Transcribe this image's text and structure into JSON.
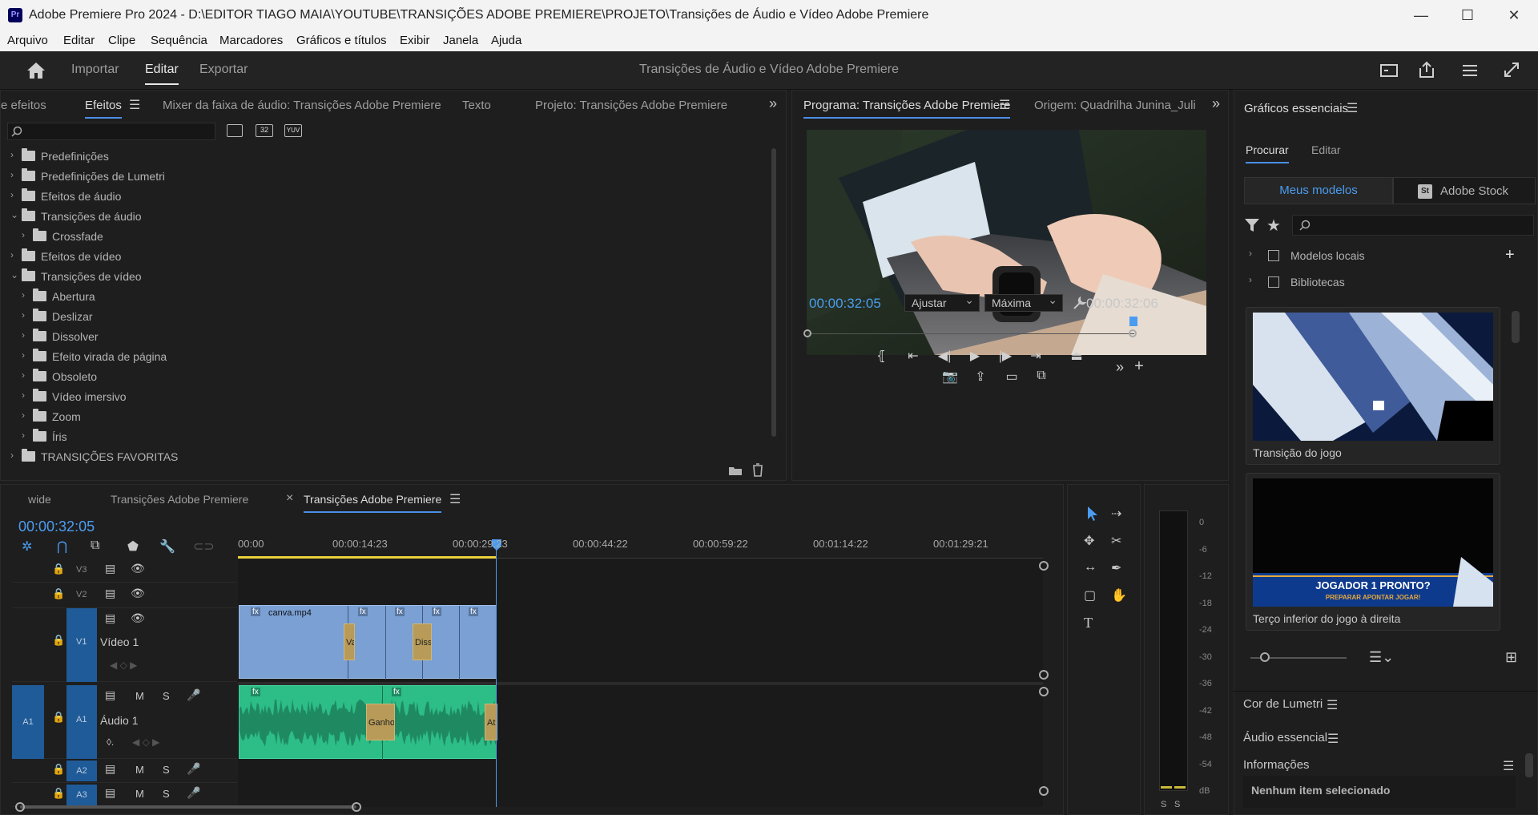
{
  "window": {
    "app_icon": "Pr",
    "title": "Adobe Premiere Pro 2024 - D:\\EDITOR TIAGO MAIA\\YOUTUBE\\TRANSIÇÕES ADOBE PREMIERE\\PROJETO\\Transições de Áudio e Vídeo Adobe Premiere",
    "minimize": "—",
    "maximize": "☐",
    "close": "✕"
  },
  "menu": [
    "Arquivo",
    "Editar",
    "Clipe",
    "Sequência",
    "Marcadores",
    "Gráficos e títulos",
    "Exibir",
    "Janela",
    "Ajuda"
  ],
  "topbar": {
    "home_icon": "home-icon",
    "nav": [
      "Importar",
      "Editar",
      "Exportar"
    ],
    "active_nav": "Editar",
    "project_title": "Transições de Áudio e Vídeo Adobe Premiere"
  },
  "effects_panel": {
    "tabs": [
      "e efeitos",
      "Efeitos",
      "Mixer da faixa de áudio: Transições Adobe Premiere",
      "Texto",
      "Projeto: Transições Adobe Premiere"
    ],
    "active_tab": "Efeitos",
    "search_placeholder": "",
    "filter_badges": [
      "32",
      "YUV"
    ],
    "tree": [
      {
        "label": "Predefinições",
        "level": 0,
        "expanded": false,
        "star": true
      },
      {
        "label": "Predefinições de Lumetri",
        "level": 0,
        "expanded": false,
        "star": true
      },
      {
        "label": "Efeitos de áudio",
        "level": 0,
        "expanded": false
      },
      {
        "label": "Transições de áudio",
        "level": 0,
        "expanded": true
      },
      {
        "label": "Crossfade",
        "level": 1,
        "expanded": false
      },
      {
        "label": "Efeitos de vídeo",
        "level": 0,
        "expanded": false
      },
      {
        "label": "Transições de vídeo",
        "level": 0,
        "expanded": true
      },
      {
        "label": "Abertura",
        "level": 1,
        "expanded": false
      },
      {
        "label": "Deslizar",
        "level": 1,
        "expanded": false
      },
      {
        "label": "Dissolver",
        "level": 1,
        "expanded": false
      },
      {
        "label": "Efeito virada de página",
        "level": 1,
        "expanded": false
      },
      {
        "label": "Obsoleto",
        "level": 1,
        "expanded": false
      },
      {
        "label": "Vídeo imersivo",
        "level": 1,
        "expanded": false
      },
      {
        "label": "Zoom",
        "level": 1,
        "expanded": false
      },
      {
        "label": "Íris",
        "level": 1,
        "expanded": false
      },
      {
        "label": "TRANSIÇÕES FAVORITAS",
        "level": 0,
        "expanded": false
      }
    ]
  },
  "program_monitor": {
    "tabs": [
      "Programa: Transições Adobe Premiere",
      "Origem: Quadrilha Junina_Juli"
    ],
    "active_tab": "Programa: Transições Adobe Premiere",
    "current_timecode": "00:00:32:05",
    "duration_timecode": "00:00:32:06",
    "fit": "Ajustar",
    "quality": "Máxima",
    "playhead_fraction": 0.998
  },
  "essential_graphics": {
    "title": "Gráficos essenciais",
    "tabs": [
      "Procurar",
      "Editar"
    ],
    "active_tab": "Procurar",
    "source_tabs": [
      "Meus modelos",
      "Adobe Stock"
    ],
    "stock_badge": "St",
    "search_placeholder": "",
    "locations": [
      "Modelos locais",
      "Bibliotecas"
    ],
    "templates": [
      {
        "name": "Transição do jogo"
      },
      {
        "name": "Terço inferior do jogo à direita",
        "overlay_title": "JOGADOR 1 PRONTO?",
        "overlay_sub": "PREPARAR  APONTAR  JOGAR!"
      }
    ],
    "sections": [
      "Cor de Lumetri",
      "Áudio essencial",
      "Informações"
    ],
    "info_text": "Nenhum item selecionado"
  },
  "timeline": {
    "tabs": [
      "wide",
      "Transições Adobe Premiere",
      "Transições Adobe Premiere"
    ],
    "active_tab_index": 2,
    "close_glyph": "×",
    "timecode": "00:00:32:05",
    "ruler": [
      "00:00",
      "00:00:14:23",
      "00:00:29:23",
      "00:00:44:22",
      "00:00:59:22",
      "00:01:14:22",
      "00:01:29:21"
    ],
    "tracks_video": [
      {
        "id": "V3"
      },
      {
        "id": "V2"
      },
      {
        "id": "V1",
        "name": "Vídeo 1"
      }
    ],
    "tracks_audio": [
      {
        "id": "A1",
        "name": "Áudio 1",
        "source": "A1"
      },
      {
        "id": "A2"
      },
      {
        "id": "A3"
      }
    ],
    "track_buttons": {
      "mute": "M",
      "solo": "S"
    },
    "clips": {
      "video_clip_name": "canva.mp4",
      "fx_badge": "fx",
      "transitions": [
        {
          "label": "Va"
        },
        {
          "label": "Diss"
        }
      ],
      "audio_transitions": [
        {
          "label": "Ganho"
        },
        {
          "label": "At"
        }
      ]
    }
  },
  "audio_meter": {
    "scale": [
      "0",
      "-6",
      "-12",
      "-18",
      "-24",
      "-30",
      "-36",
      "-42",
      "-48",
      "-54",
      "dB"
    ],
    "solo_labels": [
      "S",
      "S"
    ]
  },
  "colors": {
    "accent_blue": "#4b9cf0",
    "video_clip": "#7aa0d4",
    "audio_clip": "#2dbd87",
    "transition": "#b89b58",
    "work_area": "#e8d23c"
  }
}
